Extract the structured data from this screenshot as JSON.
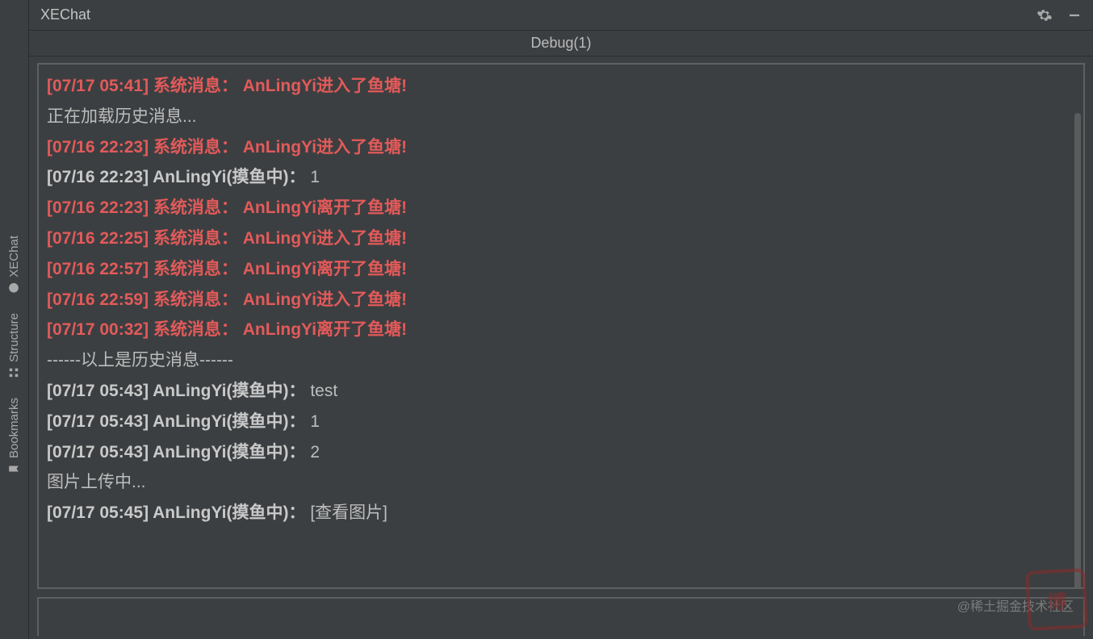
{
  "title": "XEChat",
  "tab_label": "Debug(1)",
  "sidebar": {
    "items": [
      {
        "label": "XEChat",
        "icon": "chat-icon"
      },
      {
        "label": "Structure",
        "icon": "structure-icon"
      },
      {
        "label": "Bookmarks",
        "icon": "bookmark-icon"
      }
    ]
  },
  "log": [
    {
      "type": "sys",
      "ts": "[07/17 05:41]",
      "prefix": "系统消息：",
      "body": "AnLingYi进入了鱼塘!"
    },
    {
      "type": "plain",
      "body": "正在加载历史消息..."
    },
    {
      "type": "sys",
      "ts": "[07/16 22:23]",
      "prefix": "系统消息：",
      "body": "AnLingYi进入了鱼塘!"
    },
    {
      "type": "norm",
      "ts": "[07/16 22:23]",
      "user": "AnLingYi(摸鱼中)：",
      "body": "1"
    },
    {
      "type": "sys",
      "ts": "[07/16 22:23]",
      "prefix": "系统消息：",
      "body": "AnLingYi离开了鱼塘!"
    },
    {
      "type": "sys",
      "ts": "[07/16 22:25]",
      "prefix": "系统消息：",
      "body": "AnLingYi进入了鱼塘!"
    },
    {
      "type": "sys",
      "ts": "[07/16 22:57]",
      "prefix": "系统消息：",
      "body": "AnLingYi离开了鱼塘!"
    },
    {
      "type": "sys",
      "ts": "[07/16 22:59]",
      "prefix": "系统消息：",
      "body": "AnLingYi进入了鱼塘!"
    },
    {
      "type": "sys",
      "ts": "[07/17 00:32]",
      "prefix": "系统消息：",
      "body": "AnLingYi离开了鱼塘!"
    },
    {
      "type": "plain",
      "body": "------以上是历史消息------"
    },
    {
      "type": "norm",
      "ts": "[07/17 05:43]",
      "user": "AnLingYi(摸鱼中)：",
      "body": "test"
    },
    {
      "type": "norm",
      "ts": "[07/17 05:43]",
      "user": "AnLingYi(摸鱼中)：",
      "body": "1"
    },
    {
      "type": "norm",
      "ts": "[07/17 05:43]",
      "user": "AnLingYi(摸鱼中)：",
      "body": "2"
    },
    {
      "type": "plain",
      "body": "图片上传中..."
    },
    {
      "type": "norm",
      "ts": "[07/17 05:45]",
      "user": "AnLingYi(摸鱼中)：",
      "body": "[查看图片]",
      "link": true
    }
  ],
  "input": {
    "value": ""
  },
  "watermark": "@稀土掘金技术社区",
  "stamp": "博"
}
